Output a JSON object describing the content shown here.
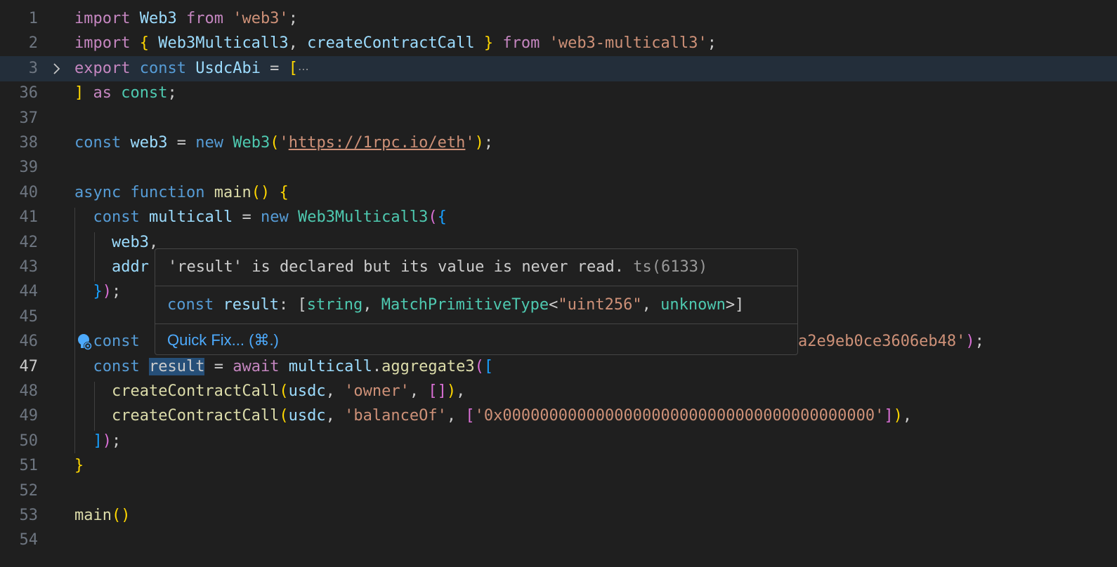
{
  "editor": {
    "lines": [
      {
        "num": "1",
        "tokens": [
          [
            "kw",
            "import"
          ],
          [
            "pun",
            " "
          ],
          [
            "var",
            "Web3"
          ],
          [
            "pun",
            " "
          ],
          [
            "kw",
            "from"
          ],
          [
            "pun",
            " "
          ],
          [
            "str",
            "'web3'"
          ],
          [
            "pun",
            ";"
          ]
        ]
      },
      {
        "num": "2",
        "tokens": [
          [
            "kw",
            "import"
          ],
          [
            "pun",
            " "
          ],
          [
            "b1",
            "{"
          ],
          [
            "pun",
            " "
          ],
          [
            "var",
            "Web3Multicall3"
          ],
          [
            "pun",
            ", "
          ],
          [
            "var",
            "createContractCall"
          ],
          [
            "pun",
            " "
          ],
          [
            "b1",
            "}"
          ],
          [
            "pun",
            " "
          ],
          [
            "kw",
            "from"
          ],
          [
            "pun",
            " "
          ],
          [
            "str",
            "'web3-multicall3'"
          ],
          [
            "pun",
            ";"
          ]
        ]
      },
      {
        "num": "3",
        "folded": true,
        "tokens": [
          [
            "kw",
            "export"
          ],
          [
            "pun",
            " "
          ],
          [
            "dec",
            "const"
          ],
          [
            "pun",
            " "
          ],
          [
            "var",
            "UsdcAbi"
          ],
          [
            "pun",
            " = "
          ],
          [
            "b1",
            "["
          ]
        ],
        "ellipsis": "⋯"
      },
      {
        "num": "36",
        "tokens": [
          [
            "b1",
            "]"
          ],
          [
            "pun",
            " "
          ],
          [
            "kw",
            "as"
          ],
          [
            "pun",
            " "
          ],
          [
            "cls",
            "const"
          ],
          [
            "pun",
            ";"
          ]
        ]
      },
      {
        "num": "37",
        "tokens": []
      },
      {
        "num": "38",
        "tokens": [
          [
            "dec",
            "const"
          ],
          [
            "pun",
            " "
          ],
          [
            "var",
            "web3"
          ],
          [
            "pun",
            " = "
          ],
          [
            "dec",
            "new"
          ],
          [
            "pun",
            " "
          ],
          [
            "cls",
            "Web3"
          ],
          [
            "b1",
            "("
          ],
          [
            "str",
            "'"
          ],
          [
            "url",
            "https://1rpc.io/eth"
          ],
          [
            "str",
            "'"
          ],
          [
            "b1",
            ")"
          ],
          [
            "pun",
            ";"
          ]
        ]
      },
      {
        "num": "39",
        "tokens": []
      },
      {
        "num": "40",
        "tokens": [
          [
            "dec",
            "async"
          ],
          [
            "pun",
            " "
          ],
          [
            "dec",
            "function"
          ],
          [
            "pun",
            " "
          ],
          [
            "fn",
            "main"
          ],
          [
            "b1",
            "()"
          ],
          [
            "pun",
            " "
          ],
          [
            "b1",
            "{"
          ]
        ]
      },
      {
        "num": "41",
        "tokens": [
          [
            "pun",
            "  "
          ],
          [
            "dec",
            "const"
          ],
          [
            "pun",
            " "
          ],
          [
            "var",
            "multicall"
          ],
          [
            "pun",
            " = "
          ],
          [
            "dec",
            "new"
          ],
          [
            "pun",
            " "
          ],
          [
            "cls",
            "Web3Multicall3"
          ],
          [
            "b2",
            "("
          ],
          [
            "b3",
            "{"
          ]
        ]
      },
      {
        "num": "42",
        "tokens": [
          [
            "pun",
            "    "
          ],
          [
            "var",
            "web3"
          ],
          [
            "pun",
            ","
          ]
        ]
      },
      {
        "num": "43",
        "tokens": [
          [
            "pun",
            "    "
          ],
          [
            "var",
            "addr"
          ]
        ]
      },
      {
        "num": "44",
        "tokens": [
          [
            "pun",
            "  "
          ],
          [
            "b3",
            "}"
          ],
          [
            "b2",
            ")"
          ],
          [
            "pun",
            ";"
          ]
        ]
      },
      {
        "num": "45",
        "tokens": []
      },
      {
        "num": "46",
        "tokens": [
          [
            "pun",
            "  "
          ],
          [
            "dec",
            "const"
          ]
        ],
        "tail": [
          [
            "str",
            "a2e9eb0ce3606eb48'"
          ],
          [
            "b2",
            ")"
          ],
          [
            "pun",
            ";"
          ]
        ]
      },
      {
        "num": "47",
        "active": true,
        "tokens": [
          [
            "pun",
            "  "
          ],
          [
            "dec",
            "const"
          ],
          [
            "pun",
            " "
          ],
          [
            "sel",
            "result"
          ],
          [
            "pun",
            " = "
          ],
          [
            "kw",
            "await"
          ],
          [
            "pun",
            " "
          ],
          [
            "var",
            "multicall"
          ],
          [
            "pun",
            "."
          ],
          [
            "fn",
            "aggregate3"
          ],
          [
            "b2",
            "("
          ],
          [
            "b3",
            "["
          ]
        ]
      },
      {
        "num": "48",
        "tokens": [
          [
            "pun",
            "    "
          ],
          [
            "fn",
            "createContractCall"
          ],
          [
            "b1",
            "("
          ],
          [
            "var",
            "usdc"
          ],
          [
            "pun",
            ", "
          ],
          [
            "str",
            "'owner'"
          ],
          [
            "pun",
            ", "
          ],
          [
            "b2",
            "[]"
          ],
          [
            "b1",
            ")"
          ],
          [
            "pun",
            ","
          ]
        ]
      },
      {
        "num": "49",
        "tokens": [
          [
            "pun",
            "    "
          ],
          [
            "fn",
            "createContractCall"
          ],
          [
            "b1",
            "("
          ],
          [
            "var",
            "usdc"
          ],
          [
            "pun",
            ", "
          ],
          [
            "str",
            "'balanceOf'"
          ],
          [
            "pun",
            ", "
          ],
          [
            "b2",
            "["
          ],
          [
            "str",
            "'0x0000000000000000000000000000000000000000'"
          ],
          [
            "b2",
            "]"
          ],
          [
            "b1",
            ")"
          ],
          [
            "pun",
            ","
          ]
        ]
      },
      {
        "num": "50",
        "tokens": [
          [
            "pun",
            "  "
          ],
          [
            "b3",
            "]"
          ],
          [
            "b2",
            ")"
          ],
          [
            "pun",
            ";"
          ]
        ]
      },
      {
        "num": "51",
        "tokens": [
          [
            "b1",
            "}"
          ]
        ]
      },
      {
        "num": "52",
        "tokens": []
      },
      {
        "num": "53",
        "tokens": [
          [
            "fn",
            "main"
          ],
          [
            "b1",
            "()"
          ]
        ]
      },
      {
        "num": "54",
        "tokens": []
      }
    ]
  },
  "hover": {
    "message": "'result' is declared but its value is never read.",
    "code_ref": "ts(6133)",
    "type_tokens": [
      [
        "dec",
        "const"
      ],
      [
        "pun",
        " "
      ],
      [
        "var",
        "result"
      ],
      [
        "pun",
        ": ["
      ],
      [
        "cls",
        "string"
      ],
      [
        "pun",
        ", "
      ],
      [
        "cls",
        "MatchPrimitiveType"
      ],
      [
        "pun",
        "<"
      ],
      [
        "str",
        "\"uint256\""
      ],
      [
        "pun",
        ", "
      ],
      [
        "cls",
        "unknown"
      ],
      [
        "pun",
        ">]"
      ]
    ],
    "quick_fix_label": "Quick Fix... (⌘.)"
  },
  "colors": {
    "background": "#1f1f1f",
    "keyword": "#c586c0",
    "declaration": "#569cd6",
    "variable": "#9cdcfe",
    "type": "#4ec9b0",
    "function": "#dcdcaa",
    "string": "#ce9178",
    "link": "#4daafc"
  },
  "icons": {
    "lightbulb": "lightbulb-autofix-icon",
    "fold": "chevron-right-icon"
  }
}
